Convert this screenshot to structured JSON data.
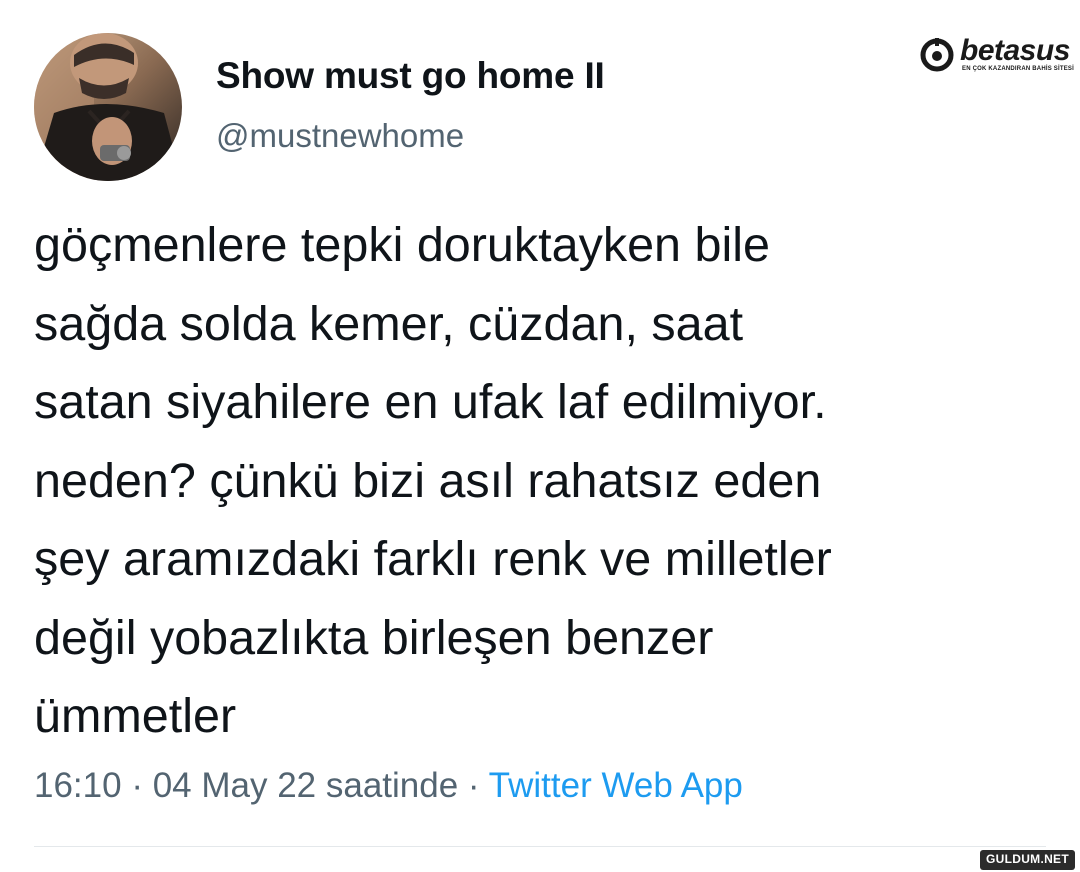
{
  "user": {
    "display_name": "Show must go home II",
    "handle": "@mustnewhome",
    "avatar_icon": "profile-photo"
  },
  "tweet": {
    "lines": [
      "göçmenlere tepki doruktayken bile",
      "sağda solda kemer, cüzdan, saat",
      "satan siyahilere en ufak laf edilmiyor.",
      "neden? çünkü bizi asıl rahatsız eden",
      "şey aramızdaki farklı renk ve milletler",
      "değil yobazlıkta birleşen benzer",
      "ümmetler"
    ]
  },
  "meta": {
    "time": "16:10",
    "separator": " · ",
    "date": "04 May 22 saatinde",
    "source": "Twitter Web App"
  },
  "watermarks": {
    "top_brand": "betasus",
    "top_tagline": "EN ÇOK KAZANDIRAN BAHİS SİTESİ",
    "bottom": "GULDUM.NET"
  },
  "colors": {
    "text": "#0f1419",
    "secondary": "#536471",
    "link": "#1d9bf0",
    "divider": "#e4e8eb"
  }
}
